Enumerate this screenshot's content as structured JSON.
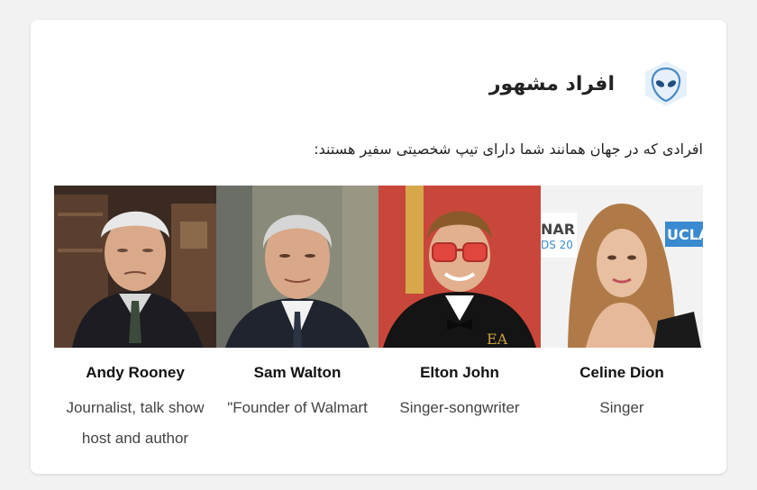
{
  "section": {
    "title": "افراد مشهور",
    "icon": "alien-icon",
    "subtitle": "افرادی که در جهان همانند شما دارای تیپ شخصیتی سفیر هستند:"
  },
  "people": [
    {
      "name": "Andy Rooney",
      "role": "Journalist, talk show host and author"
    },
    {
      "name": "Sam Walton",
      "role": "\"Founder of Walmart"
    },
    {
      "name": "Elton John",
      "role": "Singer-songwriter"
    },
    {
      "name": "Celine Dion",
      "role": "Singer"
    }
  ],
  "colors": {
    "accent": "#4a90c8",
    "icon_bg": "#e8f1fa"
  }
}
